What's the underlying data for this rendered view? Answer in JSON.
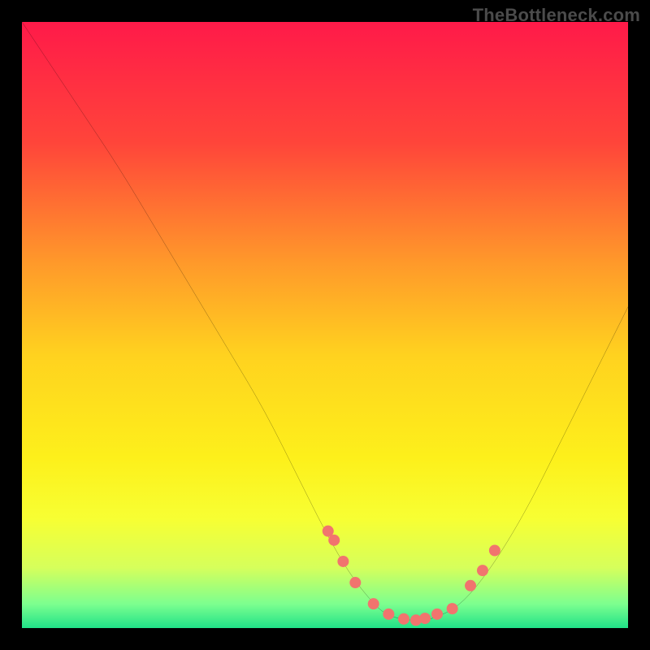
{
  "watermark": "TheBottleneck.com",
  "chart_data": {
    "type": "line",
    "title": "",
    "xlabel": "",
    "ylabel": "",
    "xlim": [
      0,
      100
    ],
    "ylim": [
      0,
      100
    ],
    "background_gradient_vertical": [
      {
        "pos": 0.0,
        "color": "#ff1a49"
      },
      {
        "pos": 0.2,
        "color": "#ff453a"
      },
      {
        "pos": 0.4,
        "color": "#ff9a2a"
      },
      {
        "pos": 0.55,
        "color": "#ffd21f"
      },
      {
        "pos": 0.72,
        "color": "#fdf01b"
      },
      {
        "pos": 0.82,
        "color": "#f7ff33"
      },
      {
        "pos": 0.9,
        "color": "#d6ff5b"
      },
      {
        "pos": 0.96,
        "color": "#7dff8f"
      },
      {
        "pos": 1.0,
        "color": "#20e288"
      }
    ],
    "series": [
      {
        "name": "bottleneck-curve",
        "type": "line",
        "color": "#000000",
        "stroke_width": 1.6,
        "x": [
          0,
          4,
          10,
          16,
          22,
          28,
          34,
          40,
          46,
          50,
          54,
          58,
          60,
          62,
          64,
          66,
          68,
          72,
          76,
          80,
          84,
          88,
          92,
          96,
          100
        ],
        "y": [
          100,
          94,
          85,
          76,
          66,
          56,
          46,
          36,
          24,
          16,
          9,
          4,
          2.3,
          1.6,
          1.3,
          1.3,
          1.6,
          3.5,
          8,
          14,
          21,
          29,
          37,
          45,
          53
        ]
      },
      {
        "name": "highlight-dots",
        "type": "scatter",
        "color": "#f1746e",
        "radius": 7,
        "x": [
          50.5,
          51.5,
          53.0,
          55.0,
          58.0,
          60.5,
          63.0,
          65.0,
          66.5,
          68.5,
          71.0,
          74.0,
          76.0,
          78.0
        ],
        "y": [
          16.0,
          14.5,
          11.0,
          7.5,
          4.0,
          2.3,
          1.5,
          1.3,
          1.6,
          2.3,
          3.2,
          7.0,
          9.5,
          12.8
        ]
      }
    ]
  }
}
